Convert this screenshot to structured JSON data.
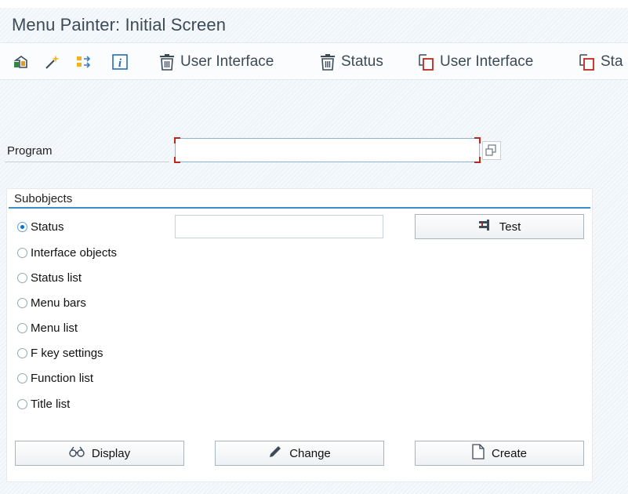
{
  "window": {
    "title": "Menu Painter: Initial Screen"
  },
  "toolbar": {
    "items": [
      {
        "icon": "other-object-icon",
        "label": ""
      },
      {
        "icon": "magic-wand-icon",
        "label": ""
      },
      {
        "icon": "where-used-icon",
        "label": ""
      },
      {
        "icon": "info-icon",
        "label": ""
      },
      {
        "icon": "trash-icon",
        "label": "User Interface"
      },
      {
        "icon": "trash-icon",
        "label": "Status"
      },
      {
        "icon": "copy-icon",
        "label": "User Interface"
      },
      {
        "icon": "copy-icon",
        "label": "Sta"
      }
    ]
  },
  "program": {
    "label": "Program",
    "value": ""
  },
  "subobjects": {
    "title": "Subobjects",
    "selected": "Status",
    "options": [
      "Status",
      "Interface objects",
      "Status list",
      "Menu bars",
      "Menu list",
      "F key settings",
      "Function list",
      "Title list"
    ],
    "status_value": "",
    "test_label": "Test"
  },
  "actions": {
    "display": "Display",
    "change": "Change",
    "create": "Create"
  },
  "colors": {
    "accent": "#3d8ecb",
    "required_marker": "#c0261c",
    "radio_selected": "#0a6ed1"
  }
}
